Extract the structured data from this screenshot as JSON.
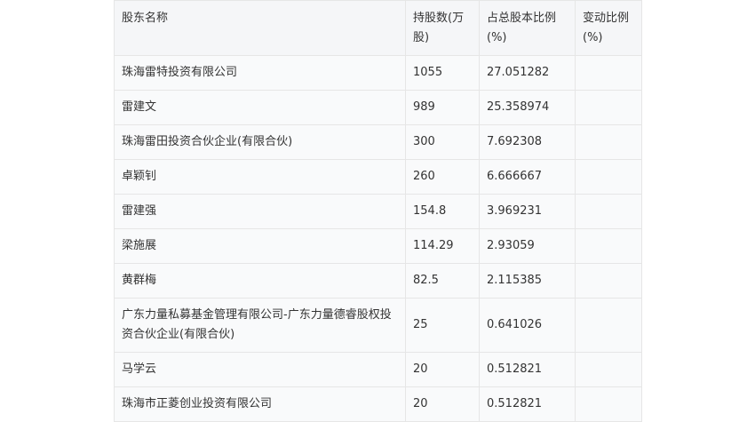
{
  "headers": [
    "股东名称",
    "持股数(万股)",
    "占总股本比例(%)",
    "变动比例(%)"
  ],
  "rows": [
    {
      "name": "珠海雷特投资有限公司",
      "shares": "1055",
      "ratio": "27.051282",
      "change": ""
    },
    {
      "name": "雷建文",
      "shares": "989",
      "ratio": "25.358974",
      "change": ""
    },
    {
      "name": "珠海雷田投资合伙企业(有限合伙)",
      "shares": "300",
      "ratio": "7.692308",
      "change": ""
    },
    {
      "name": "卓颖钊",
      "shares": "260",
      "ratio": "6.666667",
      "change": ""
    },
    {
      "name": "雷建强",
      "shares": "154.8",
      "ratio": "3.969231",
      "change": ""
    },
    {
      "name": "梁施展",
      "shares": "114.29",
      "ratio": "2.93059",
      "change": ""
    },
    {
      "name": "黄群梅",
      "shares": "82.5",
      "ratio": "2.115385",
      "change": ""
    },
    {
      "name": "广东力量私募基金管理有限公司-广东力量德睿股权投资合伙企业(有限合伙)",
      "shares": "25",
      "ratio": "0.641026",
      "change": ""
    },
    {
      "name": "马学云",
      "shares": "20",
      "ratio": "0.512821",
      "change": ""
    },
    {
      "name": "珠海市正菱创业投资有限公司",
      "shares": "20",
      "ratio": "0.512821",
      "change": ""
    }
  ]
}
